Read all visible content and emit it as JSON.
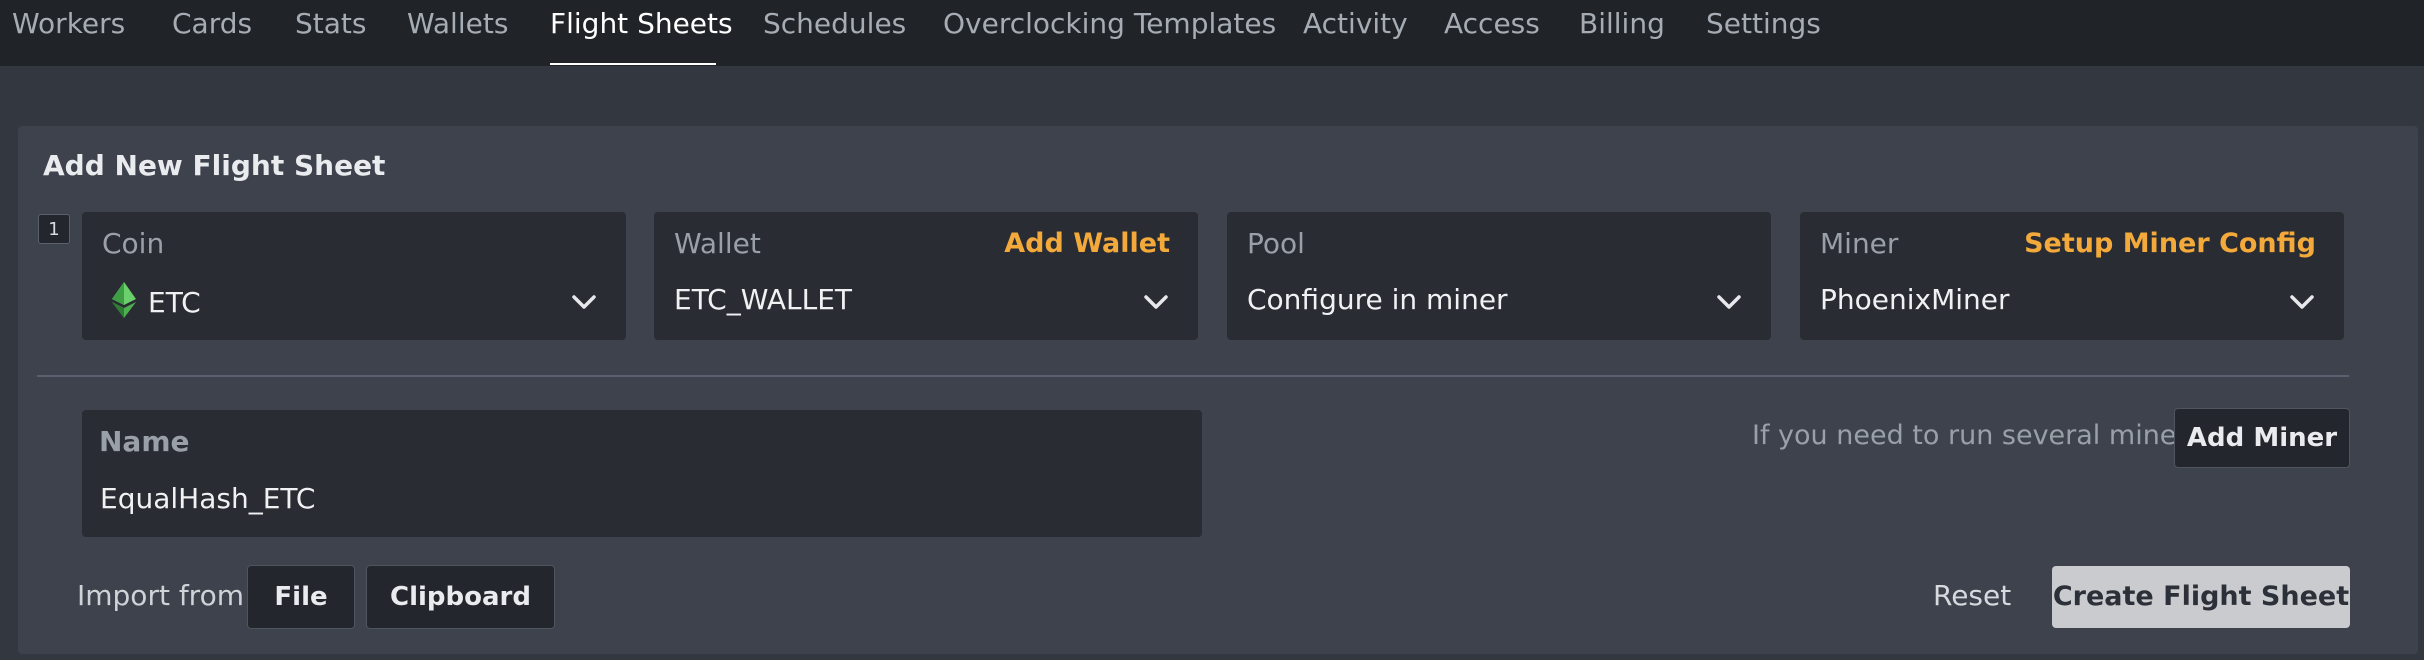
{
  "nav": {
    "tabs": [
      {
        "label": "Workers"
      },
      {
        "label": "Cards"
      },
      {
        "label": "Stats"
      },
      {
        "label": "Wallets"
      },
      {
        "label": "Flight Sheets",
        "active": true
      },
      {
        "label": "Schedules"
      },
      {
        "label": "Overclocking Templates"
      },
      {
        "label": "Activity"
      },
      {
        "label": "Access"
      },
      {
        "label": "Billing"
      },
      {
        "label": "Settings"
      }
    ]
  },
  "panel": {
    "title": "Add New Flight Sheet",
    "step": "1",
    "coin": {
      "label": "Coin",
      "value": "ETC",
      "icon": "ethereum-classic-icon",
      "icon_color": "#4caf50"
    },
    "wallet": {
      "label": "Wallet",
      "link": "Add Wallet",
      "value": "ETC_WALLET"
    },
    "pool": {
      "label": "Pool",
      "value": "Configure in miner"
    },
    "miner": {
      "label": "Miner",
      "link": "Setup Miner Config",
      "value": "PhoenixMiner"
    },
    "name": {
      "label": "Name",
      "value": "EqualHash_ETC"
    },
    "add_miner_hint": "If you need to run several miners",
    "add_miner_button": "Add Miner",
    "import_label": "Import from",
    "file_button": "File",
    "clipboard_button": "Clipboard",
    "reset_button": "Reset",
    "create_button": "Create Flight Sheet"
  },
  "colors": {
    "accent_link": "#f4a93b",
    "panel_bg": "#3d424d",
    "page_bg": "#323740",
    "nav_bg": "#202327"
  }
}
